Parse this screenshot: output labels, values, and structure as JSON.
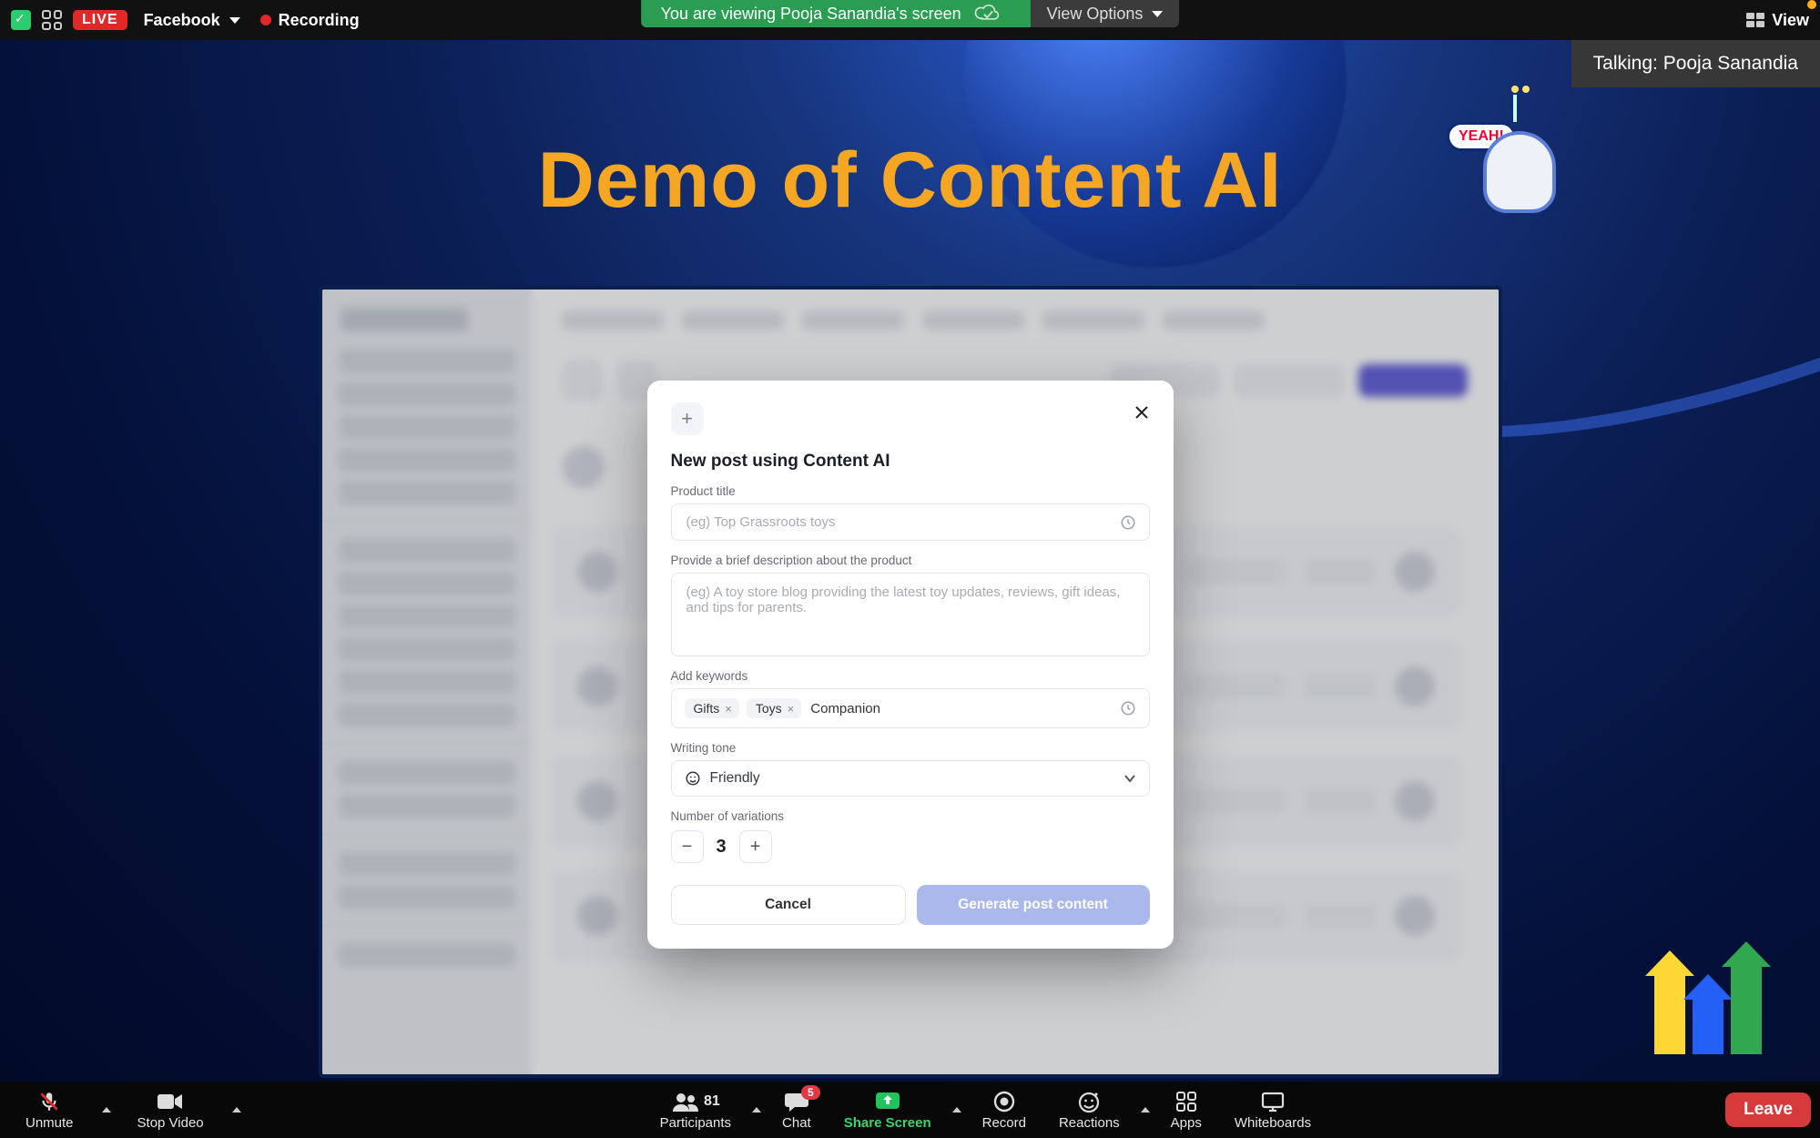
{
  "topbar": {
    "live_badge": "LIVE",
    "source": "Facebook",
    "recording_label": "Recording",
    "banner_text": "You are viewing Pooja Sanandia's screen",
    "view_options_label": "View Options",
    "view_label": "View"
  },
  "talking": {
    "text": "Talking: Pooja Sanandia"
  },
  "slide": {
    "title": "Demo of Content AI",
    "robot_bubble": "YEAH!"
  },
  "modal": {
    "heading": "New post using Content AI",
    "product_title_label": "Product title",
    "product_title_placeholder": "(eg) Top Grassroots toys",
    "description_label": "Provide a brief description about the product",
    "description_placeholder": "(eg) A toy store blog providing the latest toy updates, reviews, gift ideas, and tips for parents.",
    "keywords_label": "Add keywords",
    "keywords": [
      "Gifts",
      "Toys"
    ],
    "keywords_input": "Companion",
    "tone_label": "Writing tone",
    "tone_value": "Friendly",
    "variations_label": "Number of variations",
    "variations_value": "3",
    "cancel_label": "Cancel",
    "generate_label": "Generate post content"
  },
  "toolbar": {
    "unmute": "Unmute",
    "stop_video": "Stop Video",
    "participants": "Participants",
    "participants_count": "81",
    "chat": "Chat",
    "chat_badge": "5",
    "share_screen": "Share Screen",
    "record": "Record",
    "reactions": "Reactions",
    "apps": "Apps",
    "whiteboards": "Whiteboards",
    "leave": "Leave"
  }
}
